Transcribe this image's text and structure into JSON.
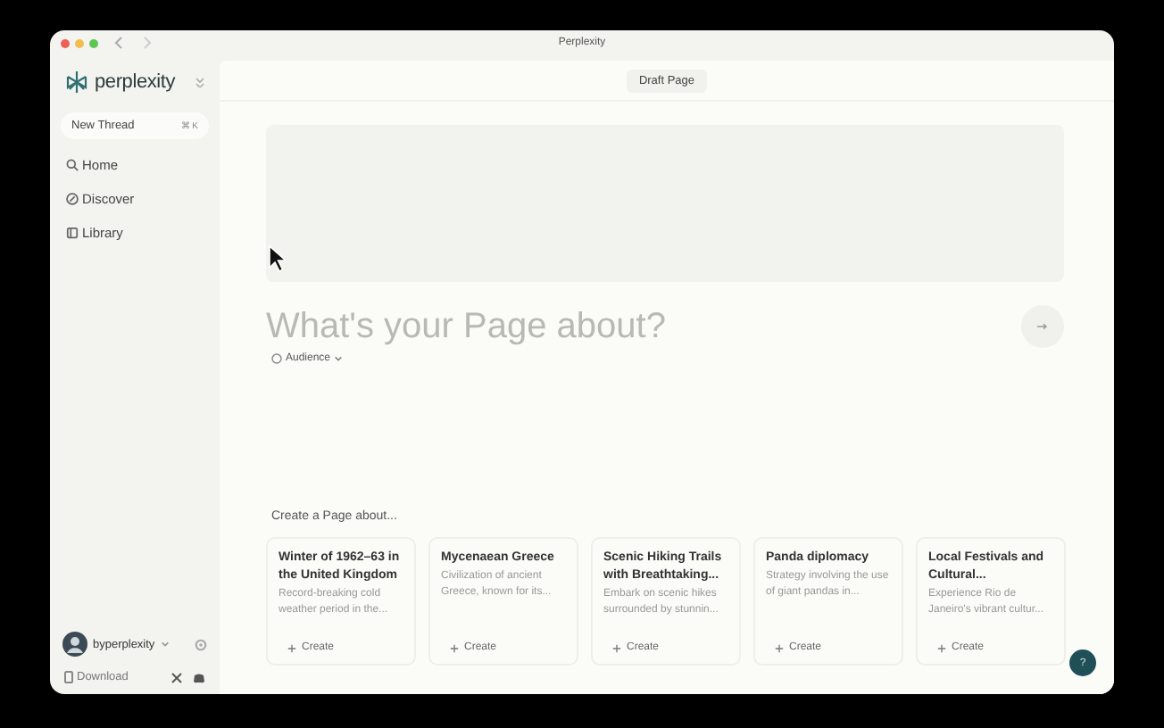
{
  "window": {
    "title": "Perplexity"
  },
  "sidebar": {
    "brand": "perplexity",
    "new_thread": {
      "label": "New Thread",
      "shortcut": "⌘",
      "key": "K"
    },
    "items": [
      {
        "label": "Home",
        "kind": "search",
        "selected": false
      },
      {
        "label": "Discover",
        "kind": "discover",
        "selected": false
      },
      {
        "label": "Library",
        "kind": "library",
        "selected": false
      }
    ],
    "user": {
      "name": "byperplexity"
    },
    "download": "Download"
  },
  "header": {
    "button": "Draft Page"
  },
  "composer": {
    "placeholder": "What's your Page about?",
    "audience": "Audience"
  },
  "suggestions": {
    "heading": "Create a Page about...",
    "cards": [
      {
        "title": "Winter of 1962–63 in the United Kingdom",
        "description": "Record-breaking cold weather period in the...",
        "action": "Create"
      },
      {
        "title": "Mycenaean Greece",
        "description": "Civilization of ancient Greece, known for its...",
        "action": "Create"
      },
      {
        "title": "Scenic Hiking Trails with Breathtaking...",
        "description": "Embark on scenic hikes surrounded by stunnin...",
        "action": "Create"
      },
      {
        "title": "Panda diplomacy",
        "description": "Strategy involving the use of giant pandas in...",
        "action": "Create"
      },
      {
        "title": "Local Festivals and Cultural...",
        "description": "Experience Rio de Janeiro's vibrant cultur...",
        "action": "Create"
      }
    ]
  },
  "help": "?"
}
